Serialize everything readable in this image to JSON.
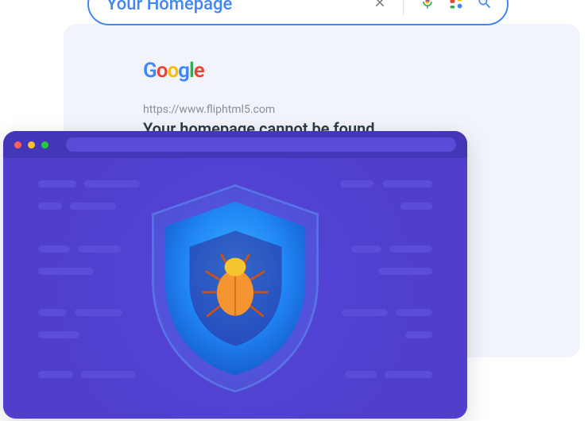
{
  "search": {
    "query": "Your Homepage",
    "logo": "Google"
  },
  "result": {
    "url": "https://www.fliphtml5.com",
    "title": "Your homepage cannot be found"
  },
  "icons": {
    "clear": "clear-icon",
    "voice": "voice-search-icon",
    "lens": "image-search-icon",
    "search": "search-icon"
  },
  "colors": {
    "brand_blue": "#4285f4",
    "purple_window": "#4f3fcc",
    "shield_light": "#2b9cff",
    "shield_dark": "#1d6ee8",
    "bug_orange": "#f59532",
    "bug_yellow": "#f4c431"
  }
}
